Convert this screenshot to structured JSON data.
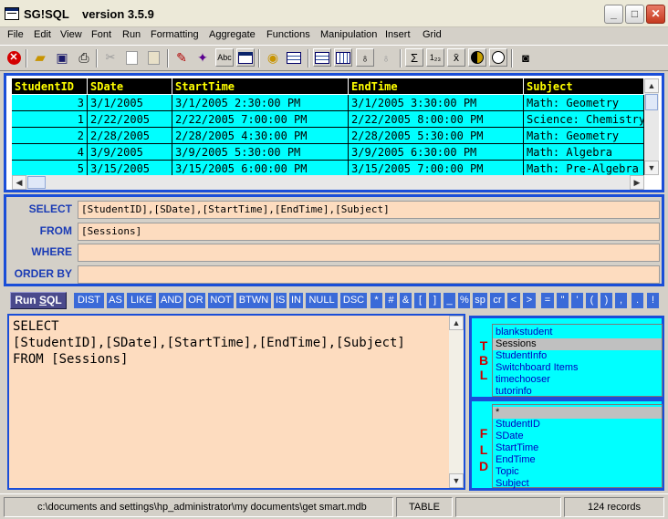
{
  "window": {
    "title": "SG!SQL    version 3.5.9",
    "minimize_label": "_",
    "maximize_label": "□",
    "close_label": "✕"
  },
  "menu": [
    "File",
    "Edit",
    "View",
    "Font",
    "Run",
    "Formatting",
    "Aggregate",
    "Functions",
    "Manipulation",
    "Insert",
    "Grid"
  ],
  "toolbar": {
    "icons": [
      "stop-icon",
      "open-folder-icon",
      "save-icon",
      "print-icon",
      "cut-icon",
      "copy-icon",
      "paste-icon",
      "marker-icon",
      "magic-wand-icon",
      "spellcheck-icon",
      "window-icon",
      "database-icon",
      "table-view-icon",
      "grid-view-icon",
      "grid-edit-icon",
      "lightbulb-icon",
      "lightbulb-off-icon",
      "sum-icon",
      "count-icon",
      "average-icon",
      "contrast-icon",
      "circle-icon",
      "camera-icon"
    ],
    "spellcheck_label": "Abc",
    "sum_label": "Σ",
    "count_label": "1₂₃",
    "average_label": "x̄"
  },
  "grid": {
    "columns": [
      "StudentID",
      "SDate",
      "StartTime",
      "EndTime",
      "Subject"
    ],
    "rows": [
      [
        "3",
        "3/1/2005",
        "3/1/2005 2:30:00 PM",
        "3/1/2005 3:30:00 PM",
        "Math: Geometry"
      ],
      [
        "1",
        "2/22/2005",
        "2/22/2005 7:00:00 PM",
        "2/22/2005 8:00:00 PM",
        "Science: Chemistry"
      ],
      [
        "2",
        "2/28/2005",
        "2/28/2005 4:30:00 PM",
        "2/28/2005 5:30:00 PM",
        "Math: Geometry"
      ],
      [
        "4",
        "3/9/2005",
        "3/9/2005 5:30:00 PM",
        "3/9/2005 6:30:00 PM",
        "Math: Algebra"
      ],
      [
        "5",
        "3/15/2005",
        "3/15/2005 6:00:00 PM",
        "3/15/2005 7:00:00 PM",
        "Math: Pre-Algebra"
      ]
    ]
  },
  "clauses": {
    "select_label": "SELECT",
    "select_value": "[StudentID],[SDate],[StartTime],[EndTime],[Subject]",
    "from_label": "FROM",
    "from_value": "[Sessions]",
    "where_label": "WHERE",
    "where_value": "",
    "orderby_label": "ORDER BY",
    "orderby_value": ""
  },
  "keywords": {
    "run_prefix": "Run ",
    "run_underlined": "S",
    "run_suffix": "QL",
    "buttons": [
      "DIST",
      "AS",
      "LIKE",
      "AND",
      "OR",
      "NOT",
      "BTWN",
      "IS",
      "IN",
      "NULL",
      "DSC",
      "*",
      "#",
      "&",
      "[",
      "]",
      "_",
      "%",
      "sp",
      "cr",
      "<",
      ">",
      "=",
      "\"",
      "'",
      "(",
      ")",
      ",",
      ".",
      "!"
    ]
  },
  "editor": {
    "text": "SELECT\n[StudentID],[SDate],[StartTime],[EndTime],[Subject]\nFROM [Sessions]"
  },
  "tables_panel": {
    "letters": [
      "T",
      "B",
      "L"
    ],
    "items": [
      "blankstudent",
      "Sessions",
      "StudentInfo",
      "Switchboard Items",
      "timechooser",
      "tutorinfo"
    ],
    "selected": "Sessions"
  },
  "fields_panel": {
    "letters": [
      "F",
      "L",
      "D"
    ],
    "items": [
      "*",
      "StudentID",
      "SDate",
      "StartTime",
      "EndTime",
      "Topic",
      "Subject"
    ],
    "selected": "*"
  },
  "status": {
    "path": "c:\\documents and settings\\hp_administrator\\my documents\\get smart.mdb",
    "mode": "TABLE",
    "records": "124 records"
  }
}
